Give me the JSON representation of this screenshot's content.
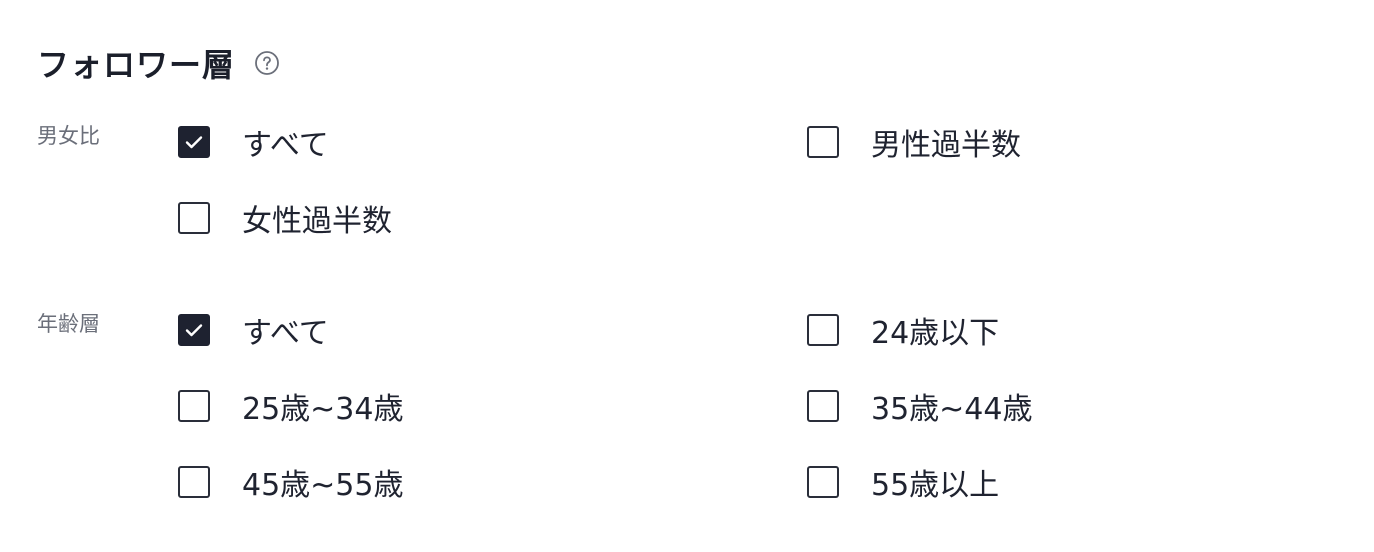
{
  "section": {
    "title": "フォロワー層",
    "help_icon": "question-circle-icon"
  },
  "gender": {
    "label": "男女比",
    "options": [
      {
        "label": "すべて",
        "checked": true
      },
      {
        "label": "男性過半数",
        "checked": false
      },
      {
        "label": "女性過半数",
        "checked": false
      }
    ]
  },
  "age": {
    "label": "年齢層",
    "options": [
      {
        "label": "すべて",
        "checked": true
      },
      {
        "label": "24歳以下",
        "checked": false
      },
      {
        "label": "25歳~34歳",
        "checked": false
      },
      {
        "label": "35歳~44歳",
        "checked": false
      },
      {
        "label": "45歳~55歳",
        "checked": false
      },
      {
        "label": "55歳以上",
        "checked": false
      }
    ]
  },
  "colors": {
    "text": "#1f2330",
    "muted": "#6b6f7a",
    "checked_fill": "#1e2230"
  }
}
